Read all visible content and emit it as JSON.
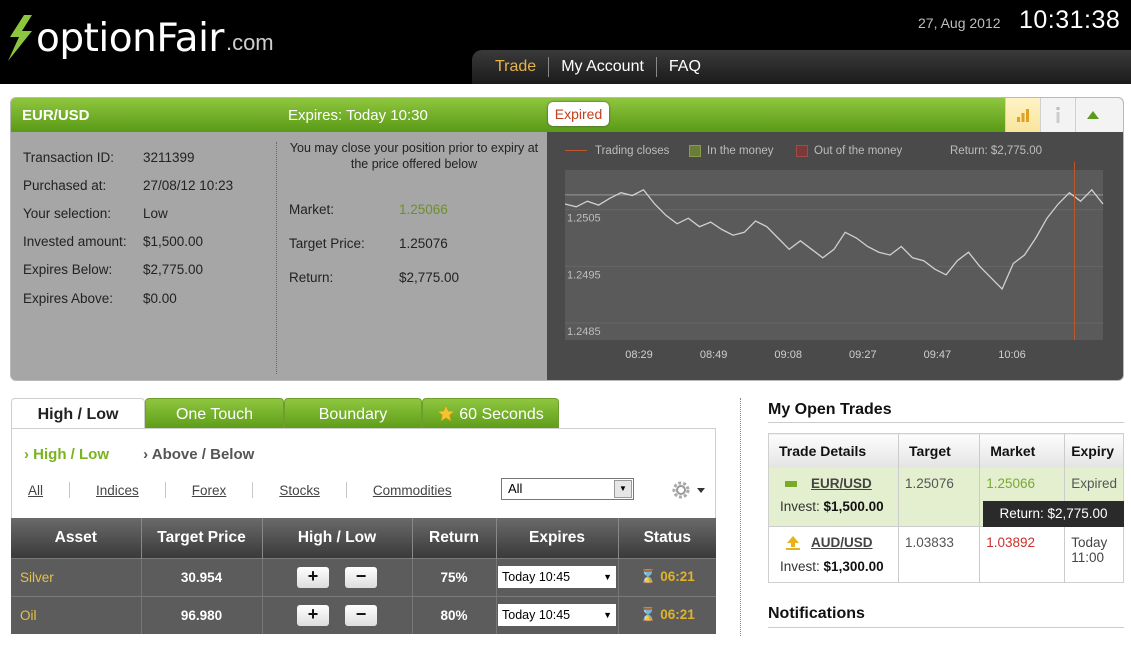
{
  "brand": {
    "logo_main": "optionFair",
    "logo_suffix": ".com"
  },
  "header": {
    "date": "27, Aug 2012",
    "time": "10:31:38"
  },
  "nav": {
    "trade": "Trade",
    "account": "My Account",
    "faq": "FAQ"
  },
  "trade_panel": {
    "pair": "EUR/USD",
    "expires": "Expires:  Today 10:30",
    "badge": "Expired",
    "details": [
      {
        "label": "Transaction ID:",
        "value": "3211399"
      },
      {
        "label": "Purchased at:",
        "value": "27/08/12 10:23"
      },
      {
        "label": "Your selection:",
        "value": "Low"
      },
      {
        "label": "Invested amount:",
        "value": "$1,500.00"
      },
      {
        "label": "Expires Below:",
        "value": "$2,775.00"
      },
      {
        "label": "Expires Above:",
        "value": "$0.00"
      }
    ],
    "note": "You may close your position prior to expiry at the price offered below",
    "market_label": "Market:",
    "market_value": "1.25066",
    "target_label": "Target Price:",
    "target_value": "1.25076",
    "return_label": "Return:",
    "return_value": "$2,775.00"
  },
  "chart_data": {
    "type": "line",
    "legend": [
      "Trading closes",
      "In the money",
      "Out of the money"
    ],
    "return_text": "Return: $2,775.00",
    "x_ticks": [
      "08:29",
      "08:49",
      "09:08",
      "09:27",
      "09:47",
      "10:06"
    ],
    "y_ticks": [
      "1.2505",
      "1.2495",
      "1.2485"
    ],
    "ylim": [
      1.2482,
      1.2512
    ],
    "target_level": 1.25076,
    "close_time_fraction": 0.947,
    "series": [
      {
        "values": [
          1.2506,
          1.25055,
          1.25065,
          1.25058,
          1.2507,
          1.2508,
          1.25075,
          1.25085,
          1.2506,
          1.2504,
          1.25025,
          1.25035,
          1.2502,
          1.25028,
          1.25015,
          1.25005,
          1.2501,
          1.2503,
          1.2502,
          1.25,
          1.2498,
          1.24995,
          1.2498,
          1.24965,
          1.2498,
          1.2501,
          1.25,
          1.24985,
          1.24975,
          1.2497,
          1.24985,
          1.24965,
          1.2496,
          1.24945,
          1.24935,
          1.2496,
          1.24975,
          1.2495,
          1.2493,
          1.2491,
          1.24955,
          1.2497,
          1.25,
          1.25035,
          1.2506,
          1.2508,
          1.25065,
          1.25085,
          1.2506
        ]
      }
    ],
    "colors": {
      "line": "#d0d0d0",
      "in_money": "#6a7b3a",
      "out_money": "#7a3a3a",
      "close": "#c0572c"
    }
  },
  "tabs": {
    "t1": "High / Low",
    "t2": "One Touch",
    "t3": "Boundary",
    "t4": "60 Seconds"
  },
  "subnav": {
    "on": "› High / Low",
    "off": "› Above / Below"
  },
  "filters": {
    "all": "All",
    "indices": "Indices",
    "forex": "Forex",
    "stocks": "Stocks",
    "commodities": "Commodities",
    "select_value": "All"
  },
  "asset_table": {
    "headers": [
      "Asset",
      "Target Price",
      "High / Low",
      "Return",
      "Expires",
      "Status"
    ],
    "rows": [
      {
        "asset": "Silver",
        "target": "30.954",
        "return": "75%",
        "expires": "Today 10:45",
        "status": "06:21"
      },
      {
        "asset": "Oil",
        "target": "96.980",
        "return": "80%",
        "expires": "Today 10:45",
        "status": "06:21"
      }
    ]
  },
  "open_trades": {
    "title": "My Open Trades",
    "headers": [
      "Trade Details",
      "Target",
      "Market",
      "Expiry"
    ],
    "rows": [
      {
        "pair": "EUR/USD",
        "invest_label": "Invest:",
        "invest": "$1,500.00",
        "target": "1.25076",
        "market": "1.25066",
        "expiry": "Expired",
        "return_text": "Return: $2,775.00"
      },
      {
        "pair": "AUD/USD",
        "invest_label": "Invest:",
        "invest": "$1,300.00",
        "target": "1.03833",
        "market": "1.03892",
        "expiry": "Today 11:00"
      }
    ]
  },
  "notifications": {
    "title": "Notifications"
  }
}
